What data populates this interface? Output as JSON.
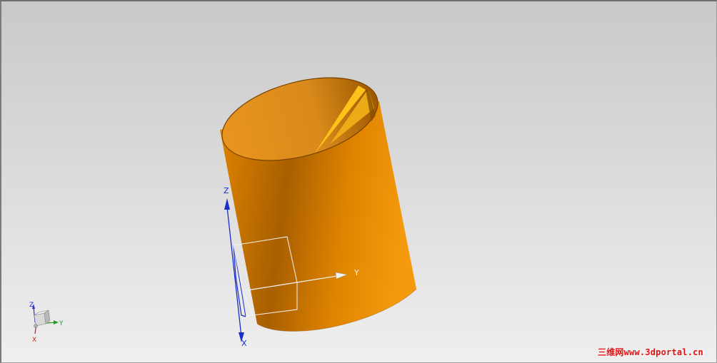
{
  "viewport": {
    "background_top": "#c9c9c9",
    "background_bottom": "#efefef"
  },
  "model": {
    "body_color_dark": "#a85f00",
    "body_color_mid": "#e08400",
    "body_color_light": "#f59a0c",
    "inner_color": "#d98a1a",
    "inner_highlight": "#ffc21a"
  },
  "csys": {
    "x_label": "X",
    "y_label": "Y",
    "z_label": "Z",
    "z_color": "#1a2ccc",
    "y_color": "#e8e8e8",
    "x_color": "#1a2ccc"
  },
  "view_triad": {
    "x_label": "X",
    "y_label": "Y",
    "z_label": "Z",
    "x_color": "#cc2020",
    "y_color": "#20a020",
    "z_color": "#2030cc"
  },
  "watermark": {
    "text": "三维网www.3dportal.cn"
  }
}
